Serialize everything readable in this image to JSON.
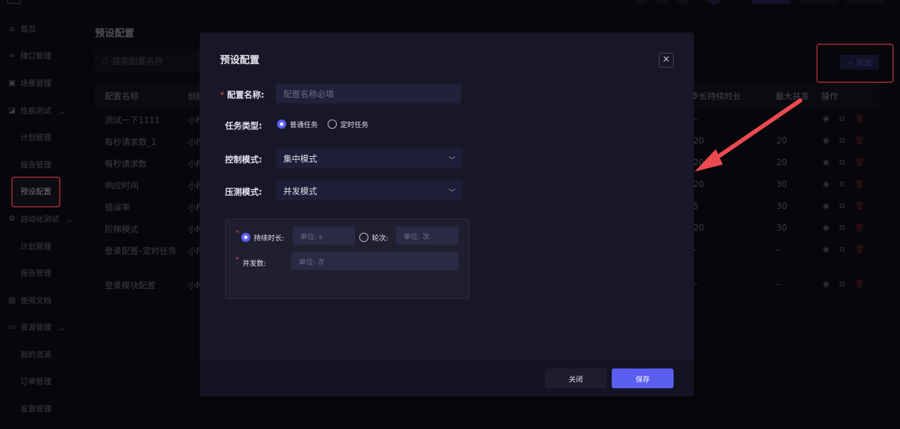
{
  "sidebar": {
    "items": [
      {
        "label": "首页",
        "icon": "home-icon"
      },
      {
        "label": "接口管理",
        "icon": "link-icon"
      },
      {
        "label": "场景管理",
        "icon": "layers-icon"
      },
      {
        "label": "性能测试",
        "icon": "chart-icon"
      },
      {
        "label": "计划管理"
      },
      {
        "label": "报告管理"
      },
      {
        "label": "预设配置"
      },
      {
        "label": "自动化测试",
        "icon": "gear-icon"
      },
      {
        "label": "计划管理"
      },
      {
        "label": "报告管理"
      },
      {
        "label": "使用文档",
        "icon": "doc-icon"
      },
      {
        "label": "资源管理",
        "icon": "monitor-icon"
      },
      {
        "label": "我的资源"
      },
      {
        "label": "订单管理"
      },
      {
        "label": "发票管理"
      }
    ]
  },
  "page": {
    "title": "预设配置",
    "search_placeholder": "搜索配置名称",
    "new_button": "+ 新建"
  },
  "table": {
    "headers": [
      "配置名称",
      "创建",
      "步长持续时长",
      "最大并发",
      "操作"
    ],
    "rows": [
      {
        "name": "测试一下1111",
        "creator": "小F",
        "step": "–",
        "max": "–"
      },
      {
        "name": "每秒请求数_1",
        "creator": "小F",
        "step": "20",
        "max": "20"
      },
      {
        "name": "每秒请求数",
        "creator": "小F",
        "step": "20",
        "max": "20"
      },
      {
        "name": "响应时间",
        "creator": "小F",
        "step": "20",
        "max": "30"
      },
      {
        "name": "错误率",
        "creator": "小F",
        "step": "5",
        "max": "30"
      },
      {
        "name": "阶梯模式",
        "creator": "小F",
        "step": "20",
        "max": "30"
      },
      {
        "name": "登录配置–定时任务",
        "creator": "小F",
        "step": "–",
        "max": "–"
      },
      {
        "name": "登录模块配置",
        "creator": "小F",
        "step": "–",
        "max": "–"
      }
    ]
  },
  "modal": {
    "title": "预设配置",
    "close_icon": "×",
    "config_name_label": "配置名称:",
    "config_name_placeholder": "配置名称必填",
    "task_type_label": "任务类型:",
    "task_type_options": [
      "普通任务",
      "定时任务"
    ],
    "task_type_selected": "普通任务",
    "control_mode_label": "控制模式:",
    "control_mode_value": "集中模式",
    "pressure_mode_label": "压测模式:",
    "pressure_mode_value": "并发模式",
    "duration_label": "持续时长:",
    "duration_placeholder": "单位: s",
    "rounds_label": "轮次:",
    "rounds_placeholder": "单位: 次",
    "concurrency_label": "并发数:",
    "concurrency_placeholder": "单位: 次",
    "cancel_button": "关闭",
    "save_button": "保存"
  },
  "colors": {
    "accent": "#5b5ff0",
    "highlight": "#e4484f",
    "background": "#0b0b14",
    "modal": "#171727"
  }
}
